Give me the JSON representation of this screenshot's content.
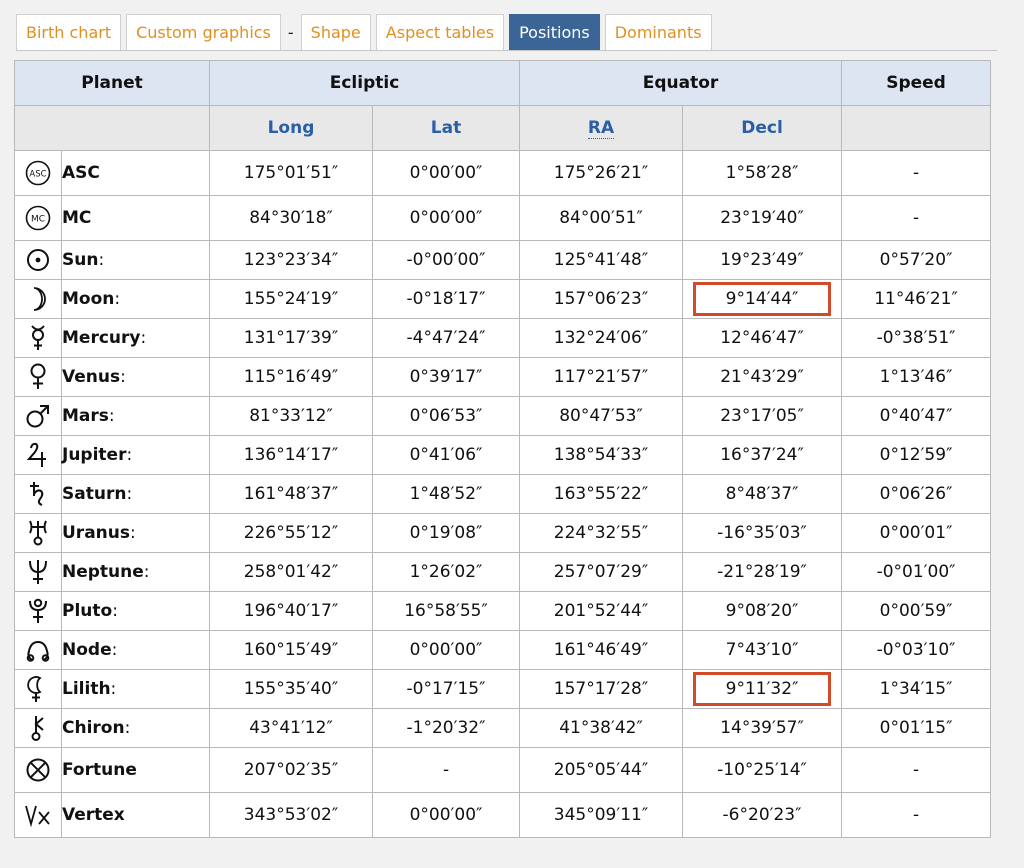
{
  "tabs": [
    {
      "label": "Birth chart",
      "active": false
    },
    {
      "label": "Custom graphics",
      "active": false
    },
    {
      "label": "Shape",
      "active": false
    },
    {
      "label": "Aspect tables",
      "active": false
    },
    {
      "label": "Positions",
      "active": true
    },
    {
      "label": "Dominants",
      "active": false
    }
  ],
  "tab_separator": "-",
  "colors": {
    "accent": "#e09020",
    "active_tab": "#3a6596",
    "header_bg": "#dde5f2",
    "subheader_text": "#2a5fa6",
    "highlight": "#d14a2a"
  },
  "table": {
    "headers": {
      "planet": "Planet",
      "ecliptic": "Ecliptic",
      "equator": "Equator",
      "speed": "Speed"
    },
    "subheaders": {
      "long": "Long",
      "lat": "Lat",
      "ra": "RA",
      "decl": "Decl"
    },
    "rows": [
      {
        "icon": "asc-icon",
        "name": "ASC",
        "colon": "",
        "long": "175°01′51″",
        "lat": "0°00′00″",
        "ra": "175°26′21″",
        "decl": "1°58′28″",
        "speed": "-",
        "highlight": false
      },
      {
        "icon": "mc-icon",
        "name": "MC",
        "colon": "",
        "long": "84°30′18″",
        "lat": "0°00′00″",
        "ra": "84°00′51″",
        "decl": "23°19′40″",
        "speed": "-",
        "highlight": false
      },
      {
        "icon": "sun-icon",
        "name": "Sun",
        "colon": ":",
        "long": "123°23′34″",
        "lat": "-0°00′00″",
        "ra": "125°41′48″",
        "decl": "19°23′49″",
        "speed": "0°57′20″",
        "highlight": false
      },
      {
        "icon": "moon-icon",
        "name": "Moon",
        "colon": ":",
        "long": "155°24′19″",
        "lat": "-0°18′17″",
        "ra": "157°06′23″",
        "decl": "9°14′44″",
        "speed": "11°46′21″",
        "highlight": true
      },
      {
        "icon": "mercury-icon",
        "name": "Mercury",
        "colon": ":",
        "long": "131°17′39″",
        "lat": "-4°47′24″",
        "ra": "132°24′06″",
        "decl": "12°46′47″",
        "speed": "-0°38′51″",
        "highlight": false
      },
      {
        "icon": "venus-icon",
        "name": "Venus",
        "colon": ":",
        "long": "115°16′49″",
        "lat": "0°39′17″",
        "ra": "117°21′57″",
        "decl": "21°43′29″",
        "speed": "1°13′46″",
        "highlight": false
      },
      {
        "icon": "mars-icon",
        "name": "Mars",
        "colon": ":",
        "long": "81°33′12″",
        "lat": "0°06′53″",
        "ra": "80°47′53″",
        "decl": "23°17′05″",
        "speed": "0°40′47″",
        "highlight": false
      },
      {
        "icon": "jupiter-icon",
        "name": "Jupiter",
        "colon": ":",
        "long": "136°14′17″",
        "lat": "0°41′06″",
        "ra": "138°54′33″",
        "decl": "16°37′24″",
        "speed": "0°12′59″",
        "highlight": false
      },
      {
        "icon": "saturn-icon",
        "name": "Saturn",
        "colon": ":",
        "long": "161°48′37″",
        "lat": "1°48′52″",
        "ra": "163°55′22″",
        "decl": "8°48′37″",
        "speed": "0°06′26″",
        "highlight": false
      },
      {
        "icon": "uranus-icon",
        "name": "Uranus",
        "colon": ":",
        "long": "226°55′12″",
        "lat": "0°19′08″",
        "ra": "224°32′55″",
        "decl": "-16°35′03″",
        "speed": "0°00′01″",
        "highlight": false
      },
      {
        "icon": "neptune-icon",
        "name": "Neptune",
        "colon": ":",
        "long": "258°01′42″",
        "lat": "1°26′02″",
        "ra": "257°07′29″",
        "decl": "-21°28′19″",
        "speed": "-0°01′00″",
        "highlight": false
      },
      {
        "icon": "pluto-icon",
        "name": "Pluto",
        "colon": ":",
        "long": "196°40′17″",
        "lat": "16°58′55″",
        "ra": "201°52′44″",
        "decl": "9°08′20″",
        "speed": "0°00′59″",
        "highlight": false
      },
      {
        "icon": "node-icon",
        "name": "Node",
        "colon": ":",
        "long": "160°15′49″",
        "lat": "0°00′00″",
        "ra": "161°46′49″",
        "decl": "7°43′10″",
        "speed": "-0°03′10″",
        "highlight": false
      },
      {
        "icon": "lilith-icon",
        "name": "Lilith",
        "colon": ":",
        "long": "155°35′40″",
        "lat": "-0°17′15″",
        "ra": "157°17′28″",
        "decl": "9°11′32″",
        "speed": "1°34′15″",
        "highlight": true
      },
      {
        "icon": "chiron-icon",
        "name": "Chiron",
        "colon": ":",
        "long": "43°41′12″",
        "lat": "-1°20′32″",
        "ra": "41°38′42″",
        "decl": "14°39′57″",
        "speed": "0°01′15″",
        "highlight": false
      },
      {
        "icon": "fortune-icon",
        "name": "Fortune",
        "colon": "",
        "long": "207°02′35″",
        "lat": "-",
        "ra": "205°05′44″",
        "decl": "-10°25′14″",
        "speed": "-",
        "highlight": false
      },
      {
        "icon": "vertex-icon",
        "name": "Vertex",
        "colon": "",
        "long": "343°53′02″",
        "lat": "0°00′00″",
        "ra": "345°09′11″",
        "decl": "-6°20′23″",
        "speed": "-",
        "highlight": false
      }
    ]
  }
}
